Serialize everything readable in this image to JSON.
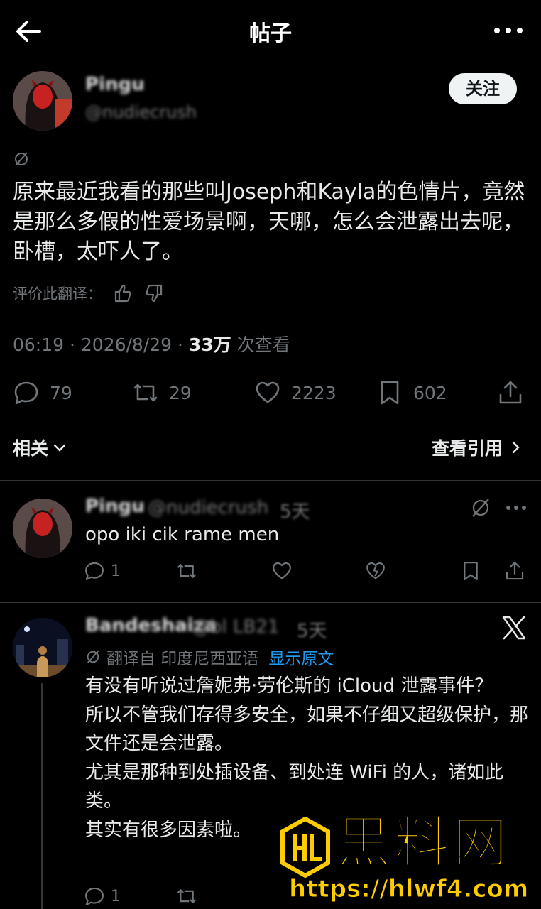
{
  "header": {
    "title": "帖子"
  },
  "post": {
    "author_name": "Pingu",
    "author_handle": "@nudiecrush",
    "follow_label": "关注",
    "text": "原来最近我看的那些叫Joseph和Kayla的色情片，竟然是那么多假的性爱场景啊，天哪，怎么会泄露出去呢，卧槽，太吓人了。",
    "rate_label": "评价此翻译：",
    "time": "06:19 · 2026/8/29 · ",
    "views_count": "33万",
    "views_label": " 次查看",
    "replies": "79",
    "reposts": "29",
    "likes": "2223",
    "bookmarks": "602",
    "related_label": "相关",
    "quotes_label": "查看引用"
  },
  "reply1": {
    "name": "Pingu",
    "handle": "@nudiecrush",
    "age": "5天",
    "text": "opo iki cik rame men",
    "replies": "1"
  },
  "reply2": {
    "name": "Bandeshaiza",
    "handle": "@bl LB21",
    "age": "5天",
    "translated_from": "翻译自 印度尼西亚语",
    "show_original": "显示原文",
    "text": "有没有听说过詹妮弗·劳伦斯的 iCloud 泄露事件？\n所以不管我们存得多安全，如果不仔细又超级保护，那文件还是会泄露。\n尤其是那种到处插设备、到处连 WiFi 的人，诸如此类。\n其实有很多因素啦。",
    "replies": "1"
  },
  "watermark": {
    "logo_text": "HL",
    "brand": "黑料网",
    "url": "https://hlwf4.com"
  },
  "colors": {
    "accent": "#1d9bf0",
    "muted": "#71767b",
    "watermark": "#ffcc00"
  }
}
